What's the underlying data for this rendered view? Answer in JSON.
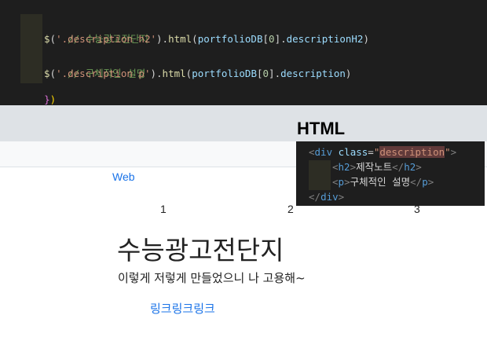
{
  "code": {
    "line1_comment": "// 수능광고전단지",
    "line2": {
      "dollar": "$",
      "open": "(",
      "selector": "'.description h2'",
      "close_dot": ").",
      "method": "html",
      "paren": "(",
      "var": "portfolioDB",
      "lb": "[",
      "index": "0",
      "rb_dot": "].",
      "prop": "descriptionH2",
      "end": ")"
    },
    "line3_comment": "// 구체적인 설명",
    "line4": {
      "dollar": "$",
      "open": "(",
      "selector": "'.description p'",
      "close_dot": ").",
      "method": "html",
      "paren": "(",
      "var": "portfolioDB",
      "lb": "[",
      "index": "0",
      "rb_dot": "].",
      "prop": "description",
      "end": ")"
    },
    "line5": {
      "brace": "}",
      "paren": ")"
    }
  },
  "section_heading": "HTML",
  "html_snippet": {
    "l1": {
      "lt": "<",
      "tag": "div",
      "attr": "class",
      "eq": "=",
      "q1": "\"",
      "val": "description",
      "q2": "\"",
      "gt": ">"
    },
    "l2": {
      "lt": "<",
      "tag": "h2",
      "gt": ">",
      "text": "제작노트",
      "clt": "</",
      "ctag": "h2",
      "cgt": ">"
    },
    "l3": {
      "lt": "<",
      "tag": "p",
      "gt": ">",
      "text": "구체적인 설명",
      "clt": "</",
      "ctag": "p",
      "cgt": ">"
    },
    "l4": {
      "clt": "</",
      "ctag": "div",
      "cgt": ">"
    }
  },
  "content": {
    "category_link": "Web",
    "pages": [
      "1",
      "2",
      "3"
    ],
    "title": "수능광고전단지",
    "description": "이렇게 저렇게 만들었으니 나 고용해~",
    "link": "링크링크링크"
  }
}
